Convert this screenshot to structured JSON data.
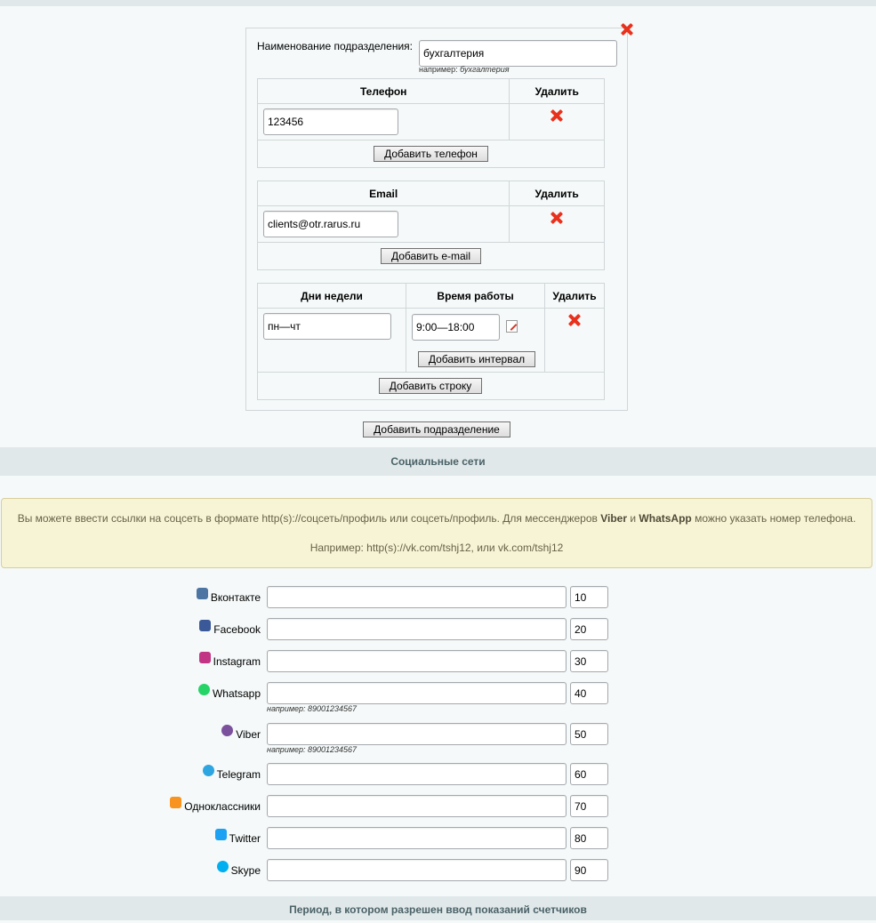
{
  "department": {
    "name_label": "Наименование подразделения:",
    "name_value": "бухгалтерия",
    "name_hint_prefix": "например:",
    "name_hint_example": "бухгалтерия",
    "phone_table": {
      "col_phone": "Телефон",
      "col_delete": "Удалить",
      "phone_value": "123456",
      "add_button": "Добавить телефон"
    },
    "email_table": {
      "col_email": "Email",
      "col_delete": "Удалить",
      "email_value": "clients@otr.rarus.ru",
      "add_button": "Добавить e-mail"
    },
    "schedule_table": {
      "col_days": "Дни недели",
      "col_time": "Время работы",
      "col_delete": "Удалить",
      "days_value": "пн—чт",
      "time_value": "9:00—18:00",
      "add_interval_button": "Добавить интервал",
      "add_row_button": "Добавить строку"
    }
  },
  "add_department_button": "Добавить подразделение",
  "social_section_title": "Социальные сети",
  "notice": {
    "line1_part1": "Вы можете ввести ссылки на соцсеть в формате http(s)://соцсеть/профиль или соцсеть/профиль. Для мессенджеров ",
    "viber": "Viber",
    "and": " и ",
    "whatsapp": "WhatsApp",
    "line1_part2": " можно указать номер телефона.",
    "line2": "Например: http(s)://vk.com/tshj12, или vk.com/tshj12"
  },
  "social": [
    {
      "label": "Вконтакте",
      "icon": "vk-icon",
      "color": "#4c75a3",
      "link": "",
      "sort": "10",
      "hint": ""
    },
    {
      "label": "Facebook",
      "icon": "facebook-icon",
      "color": "#3b5998",
      "link": "",
      "sort": "20",
      "hint": ""
    },
    {
      "label": "Instagram",
      "icon": "instagram-icon",
      "color": "#c13584",
      "link": "",
      "sort": "30",
      "hint": ""
    },
    {
      "label": "Whatsapp",
      "icon": "whatsapp-icon",
      "color": "#25d366",
      "link": "",
      "sort": "40",
      "hint": "например: 89001234567"
    },
    {
      "label": "Viber",
      "icon": "viber-icon",
      "color": "#7b519d",
      "link": "",
      "sort": "50",
      "hint": "например: 89001234567"
    },
    {
      "label": "Telegram",
      "icon": "telegram-icon",
      "color": "#2ca5e0",
      "link": "",
      "sort": "60",
      "hint": ""
    },
    {
      "label": "Одноклассники",
      "icon": "odnoklassniki-icon",
      "color": "#f7931e",
      "link": "",
      "sort": "70",
      "hint": ""
    },
    {
      "label": "Twitter",
      "icon": "twitter-icon",
      "color": "#1da1f2",
      "link": "",
      "sort": "80",
      "hint": ""
    },
    {
      "label": "Skype",
      "icon": "skype-icon",
      "color": "#00aff0",
      "link": "",
      "sort": "90",
      "hint": ""
    }
  ],
  "period_section_title": "Период, в котором разрешен ввод показаний счетчиков"
}
